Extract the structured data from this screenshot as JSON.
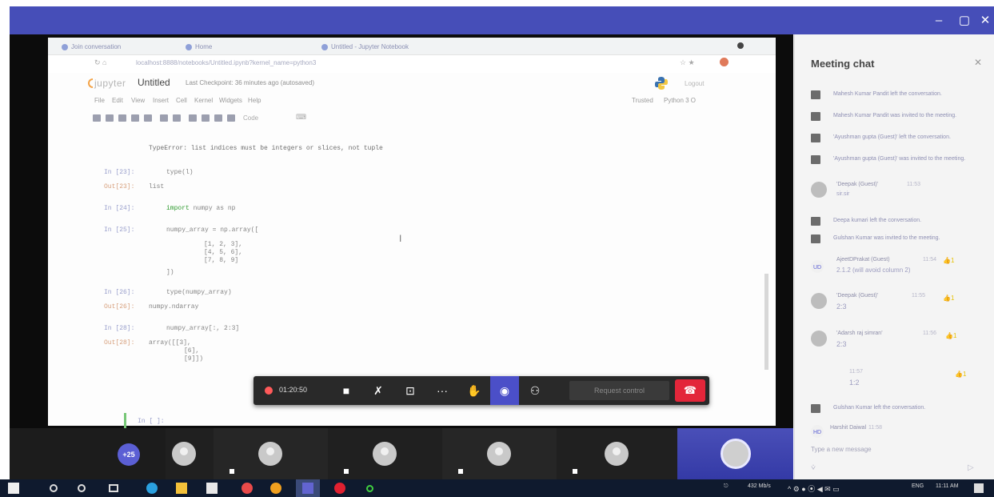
{
  "window": {
    "controls": {
      "minimize": "–",
      "maximize": "▢",
      "close": "✕"
    }
  },
  "browser": {
    "tabs": [
      {
        "label": "Join conversation"
      },
      {
        "label": "Home"
      },
      {
        "label": "Untitled - Jupyter Notebook"
      }
    ],
    "url": "localhost:8888/notebooks/Untitled.ipynb?kernel_name=python3"
  },
  "jupyter": {
    "logo_text": "jupyter",
    "notebook_title": "Untitled",
    "checkpoint": "Last Checkpoint: 36 minutes ago (autosaved)",
    "logout": "Logout",
    "menu": [
      "File",
      "Edit",
      "View",
      "Insert",
      "Cell",
      "Kernel",
      "Widgets",
      "Help"
    ],
    "kernel_info": "Trusted",
    "kernel_name": "Python 3 O",
    "cell_type": "Code",
    "cells": [
      {
        "kind": "error",
        "text": "TypeError: list indices must be integers or slices, not tuple"
      },
      {
        "kind": "in",
        "prompt": "In [23]:",
        "code": "type(l)"
      },
      {
        "kind": "out",
        "prompt": "Out[23]:",
        "code": "list"
      },
      {
        "kind": "in",
        "prompt": "In [24]:",
        "keyword": "import",
        "code": " numpy as np"
      },
      {
        "kind": "in",
        "prompt": "In [25]:",
        "code": "numpy_array = np.array(["
      },
      {
        "kind": "cont",
        "code": "[1, 2, 3],"
      },
      {
        "kind": "cont",
        "code": "[4, 5, 6],"
      },
      {
        "kind": "cont",
        "code": "[7, 8, 9]"
      },
      {
        "kind": "cont",
        "code": "])"
      },
      {
        "kind": "in",
        "prompt": "In [26]:",
        "code": "type(numpy_array)"
      },
      {
        "kind": "out",
        "prompt": "Out[26]:",
        "code": "numpy.ndarray"
      },
      {
        "kind": "in",
        "prompt": "In [28]:",
        "code": "numpy_array[:, 2:3]"
      },
      {
        "kind": "out",
        "prompt": "Out[28]:",
        "code": "array([[3],"
      },
      {
        "kind": "cont2",
        "code": "[6],"
      },
      {
        "kind": "cont2",
        "code": "[9]])"
      },
      {
        "kind": "in",
        "prompt": "In [ ]:",
        "code": ""
      }
    ]
  },
  "callbar": {
    "rec_time": "01:20:50",
    "request_control": "Request control"
  },
  "participants": {
    "more_label": "+25"
  },
  "chat": {
    "title": "Meeting chat",
    "messages": [
      {
        "type": "system",
        "text": "Mahesh Kumar Pandit left the conversation."
      },
      {
        "type": "system",
        "text": "Mahesh Kumar Pandit was invited to the meeting."
      },
      {
        "type": "system",
        "text": "'Ayushman gupta (Guest)' left the conversation."
      },
      {
        "type": "system",
        "text": "'Ayushman gupta (Guest)' was invited to the meeting."
      },
      {
        "type": "user",
        "name": "'Deepak (Guest)'",
        "time": "11:53",
        "text": "sir.sir"
      },
      {
        "type": "system",
        "text": "Deepa kumari left the conversation."
      },
      {
        "type": "system",
        "text": "Gulshan Kumar was invited to the meeting."
      },
      {
        "type": "user",
        "name": "AjeetDPrakat (Guest)",
        "time": "11:54",
        "text": "2.1.2 (will avoid column 2)",
        "initials": "UD",
        "like": "👍1"
      },
      {
        "type": "user",
        "name": "'Deepak (Guest)'",
        "time": "11:55",
        "text": "2:3",
        "like": "👍1"
      },
      {
        "type": "user",
        "name": "'Adarsh raj simran'",
        "time": "11:56",
        "text": "2:3",
        "like": "👍1"
      },
      {
        "type": "cont",
        "time": "11:57",
        "text": "1:2",
        "like": "👍1"
      },
      {
        "type": "system",
        "text": "Gulshan Kumar left the conversation."
      },
      {
        "type": "user",
        "name": "Harshit Daiwal",
        "time": "11:58",
        "text": "",
        "initials": "HD"
      }
    ],
    "compose_placeholder": "Type a new message"
  },
  "taskbar": {
    "network_speed": "432 Mb/s",
    "lang": "ENG",
    "time": "11:11 AM"
  }
}
